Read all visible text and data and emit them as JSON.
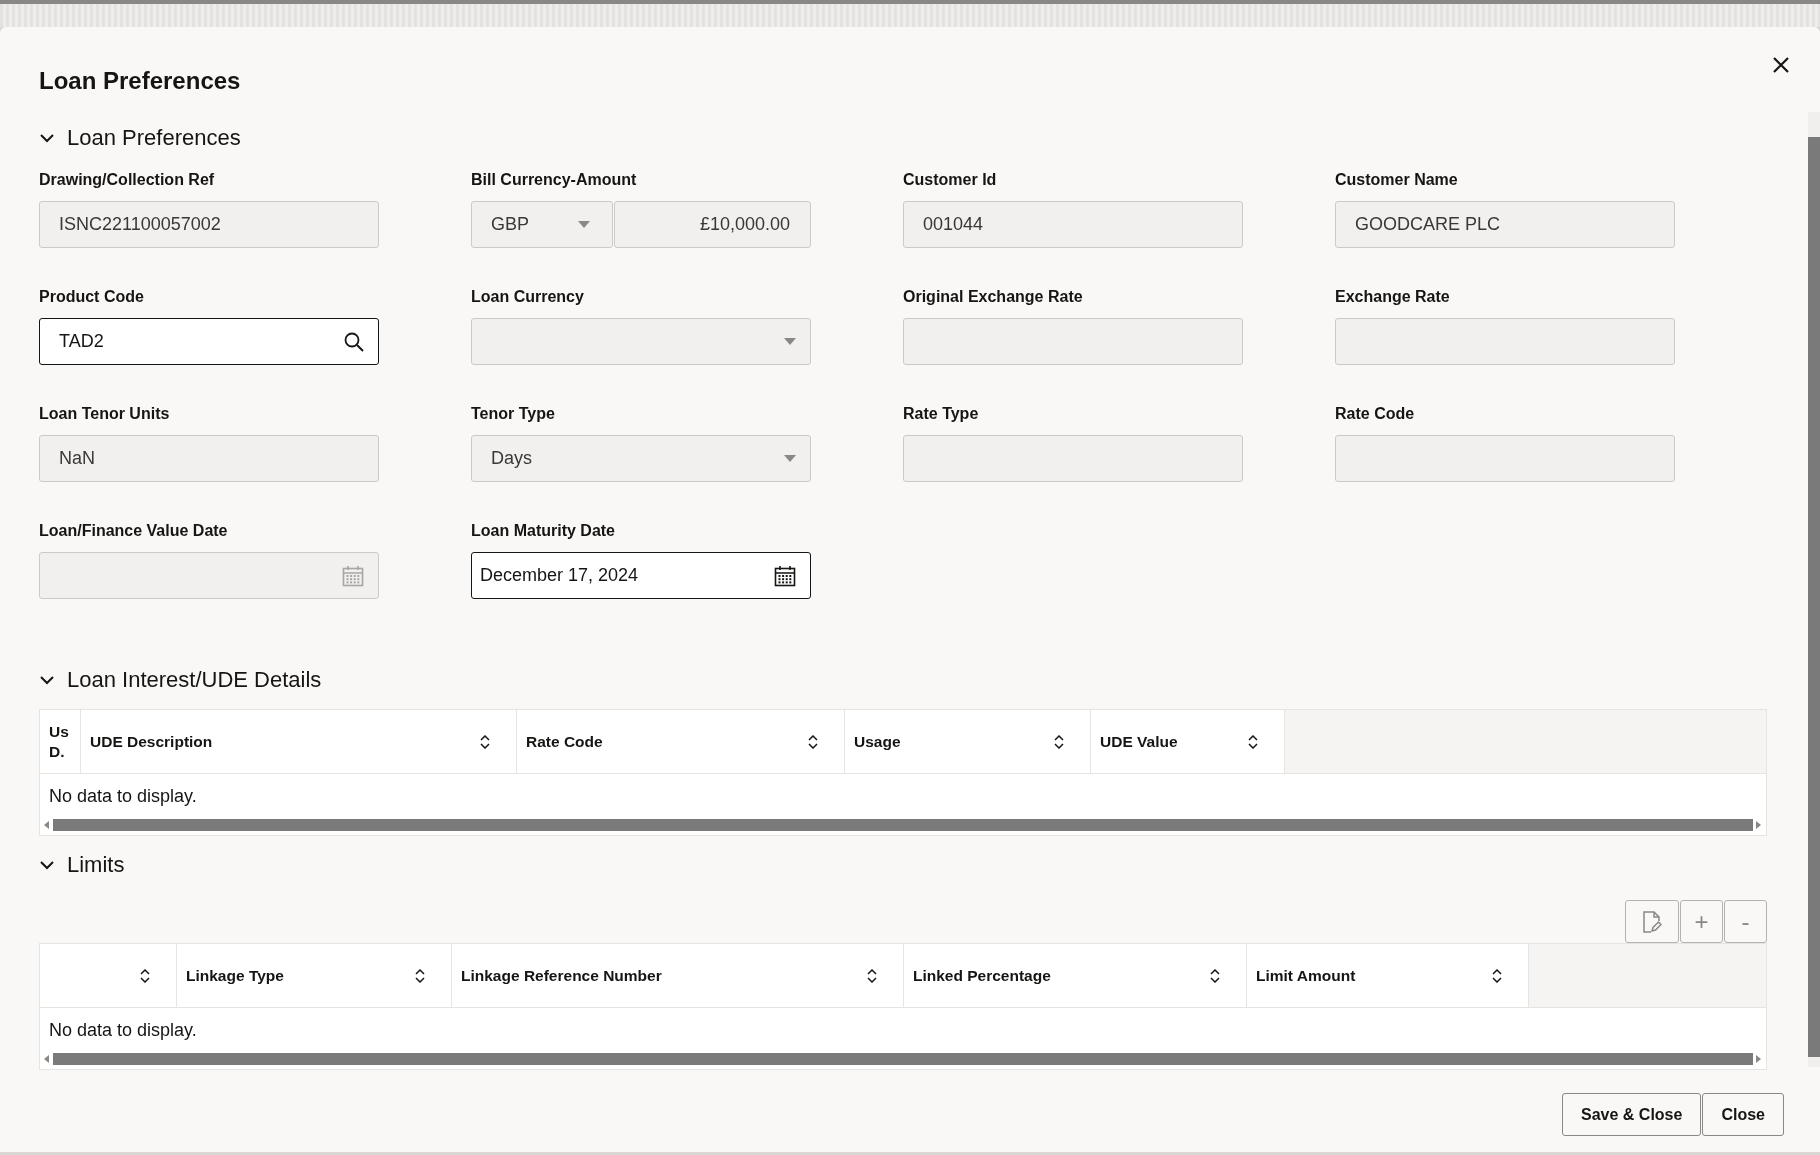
{
  "dialog": {
    "title": "Loan Preferences"
  },
  "sections": [
    {
      "title": "Loan Preferences",
      "expanded": true,
      "kind": "form",
      "fields": [
        {
          "label": "Drawing/Collection Ref",
          "kind": "text",
          "value": "ISNC221100057002",
          "disabled": true
        },
        {
          "label": "Bill Currency-Amount",
          "kind": "currency-amount",
          "currency": "GBP",
          "amount": "£10,000.00",
          "disabled": true
        },
        {
          "label": "Customer Id",
          "kind": "text",
          "value": "001044",
          "disabled": true
        },
        {
          "label": "Customer Name",
          "kind": "text",
          "value": "GOODCARE PLC",
          "disabled": true
        },
        {
          "label": "Product Code",
          "kind": "search",
          "value": "TAD2",
          "disabled": false
        },
        {
          "label": "Loan Currency",
          "kind": "select",
          "disabled": true
        },
        {
          "label": "Original Exchange Rate",
          "kind": "text",
          "disabled": true
        },
        {
          "label": "Exchange Rate",
          "kind": "text",
          "disabled": true
        },
        {
          "label": "Loan Tenor Units",
          "kind": "text",
          "value": "NaN",
          "disabled": true
        },
        {
          "label": "Tenor Type",
          "kind": "select",
          "value": "Days",
          "disabled": true
        },
        {
          "label": "Rate Type",
          "kind": "text",
          "disabled": true
        },
        {
          "label": "Rate Code",
          "kind": "text",
          "disabled": true
        },
        {
          "label": "Loan/Finance Value Date",
          "kind": "date",
          "disabled": true
        },
        {
          "label": "Loan Maturity Date",
          "kind": "date",
          "value": "December 17, 2024",
          "disabled": false
        }
      ]
    },
    {
      "title": "Loan Interest/UDE Details",
      "expanded": true,
      "kind": "table",
      "columns": [
        {
          "label": "Us D.",
          "sortable": false
        },
        {
          "label": "UDE Description",
          "sortable": true
        },
        {
          "label": "Rate Code",
          "sortable": true
        },
        {
          "label": "Usage",
          "sortable": true
        },
        {
          "label": "UDE Value",
          "sortable": true
        }
      ],
      "empty_message": "No data to display."
    },
    {
      "title": "Limits",
      "expanded": true,
      "kind": "table",
      "toolbar": [
        {
          "kind": "edit"
        },
        {
          "kind": "text",
          "label": "+"
        },
        {
          "kind": "text",
          "label": "-"
        }
      ],
      "columns": [
        {
          "sortable": true
        },
        {
          "label": "Linkage Type",
          "sortable": true
        },
        {
          "label": "Linkage Reference Number",
          "sortable": true
        },
        {
          "label": "Linked Percentage",
          "sortable": true
        },
        {
          "label": "Limit Amount",
          "sortable": true
        }
      ],
      "empty_message": "No data to display."
    }
  ],
  "buttons": [
    {
      "label": "Save & Close"
    },
    {
      "label": "Close"
    }
  ]
}
